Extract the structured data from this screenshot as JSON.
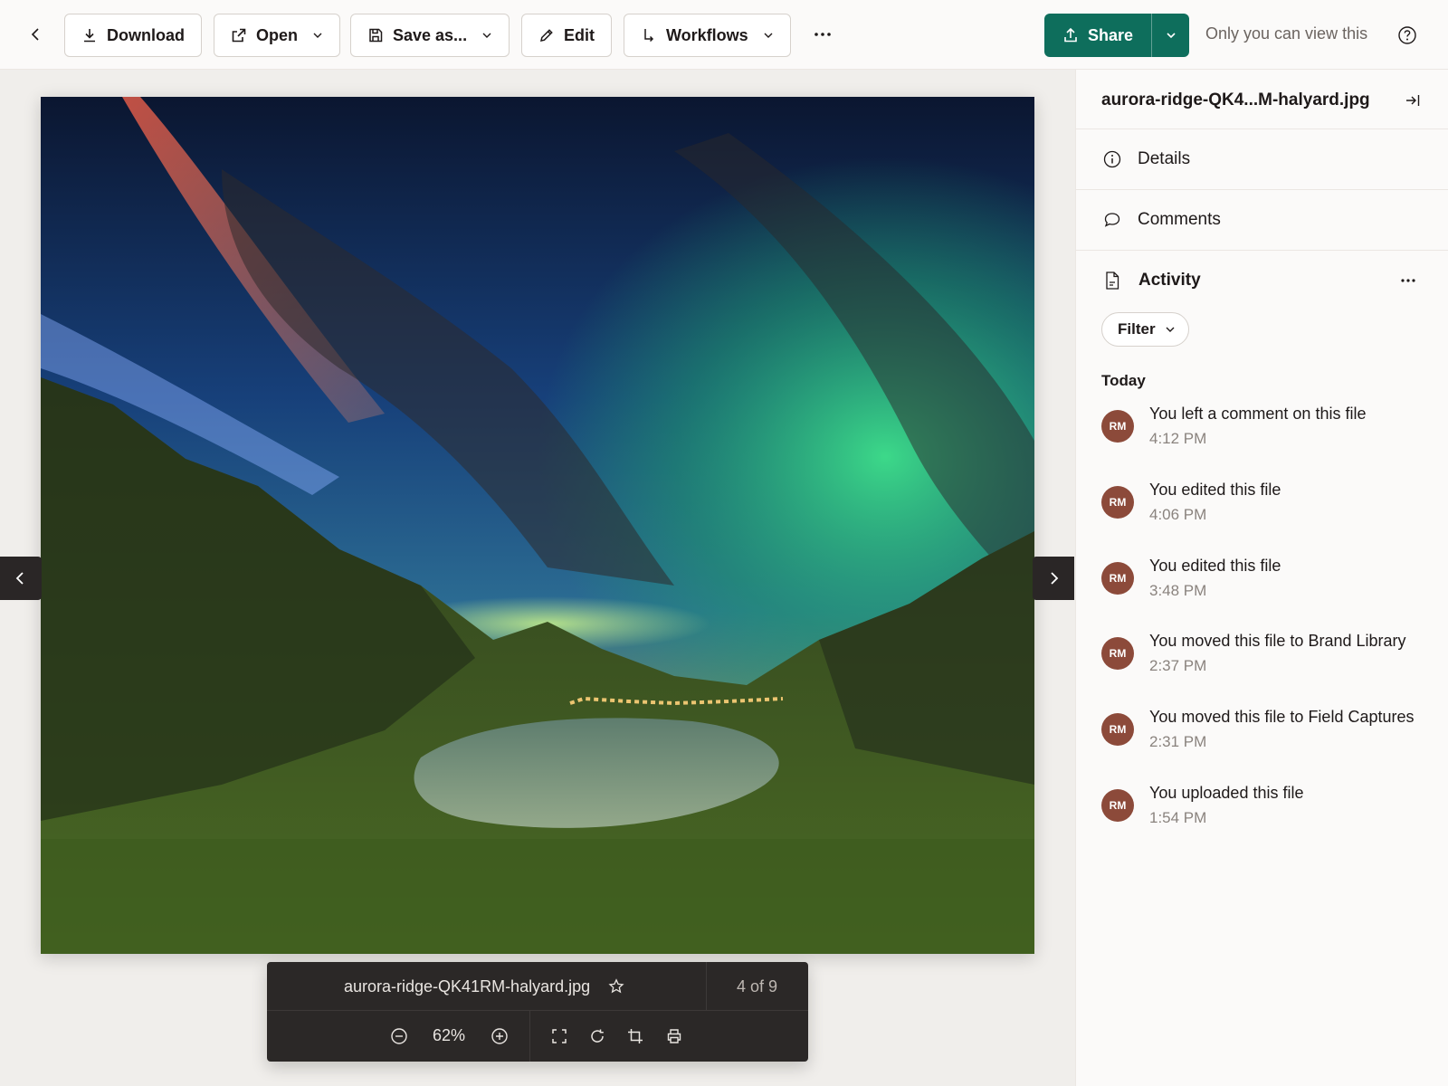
{
  "toolbar": {
    "download_label": "Download",
    "open_label": "Open",
    "save_as_label": "Save as...",
    "edit_label": "Edit",
    "workflows_label": "Workflows",
    "share_label": "Share",
    "visibility_text": "Only you can view this"
  },
  "viewer": {
    "file_name": "aurora-ridge-QK41RM-halyard.jpg",
    "position_text": "4 of 9",
    "zoom_text": "62%"
  },
  "panel": {
    "title": "aurora-ridge-QK4...M-halyard.jpg",
    "details_label": "Details",
    "comments_label": "Comments",
    "activity_label": "Activity",
    "filter_label": "Filter",
    "section_label": "Today",
    "activity": [
      {
        "initials": "RM",
        "text": "You left a comment on this file",
        "time": "4:12 PM"
      },
      {
        "initials": "RM",
        "text": "You edited this file",
        "time": "4:06 PM"
      },
      {
        "initials": "RM",
        "text": "You edited this file",
        "time": "3:48 PM"
      },
      {
        "initials": "RM",
        "text": "You moved this file to Brand Library",
        "time": "2:37 PM"
      },
      {
        "initials": "RM",
        "text": "You moved this file to Field Captures",
        "time": "2:31 PM"
      },
      {
        "initials": "RM",
        "text": "You uploaded this file",
        "time": "1:54 PM"
      }
    ]
  },
  "colors": {
    "accent": "#0e6e5c",
    "avatar": "#8c4a3a",
    "bottom_bar": "#2b2827"
  }
}
